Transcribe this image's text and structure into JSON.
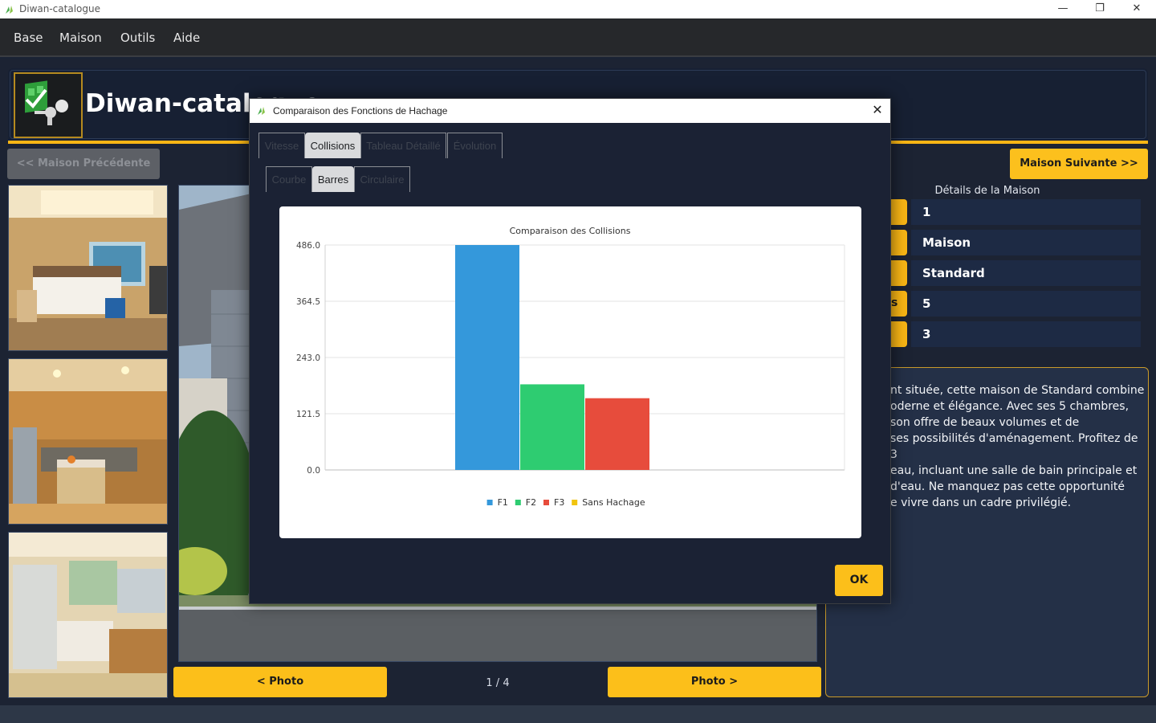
{
  "window": {
    "title": "Diwan-catalogue",
    "controls": [
      "—",
      "❐",
      "✕"
    ]
  },
  "menu": [
    "Base",
    "Maison",
    "Outils",
    "Aide"
  ],
  "header": {
    "app_title": "Diwan-catalogue"
  },
  "nav": {
    "prev_label": "<< Maison Précédente",
    "next_label": "Maison Suivante >>"
  },
  "photos": {
    "prev_label": "< Photo",
    "next_label": "Photo >",
    "counter": "1 / 4"
  },
  "details": {
    "title": "Détails de la Maison",
    "rows": [
      {
        "key_peek": "",
        "value": "1"
      },
      {
        "key_peek": "",
        "value": "Maison"
      },
      {
        "key_peek": "",
        "value": "Standard"
      },
      {
        "key_peek": "s",
        "value": "5"
      },
      {
        "key_peek": "",
        "value": "3"
      }
    ],
    "description": "nt située, cette maison de Standard combine\noderne et élégance. Avec ses 5 chambres,\nson offre de beaux volumes et de\nses possibilités d'aménagement. Profitez de 3\neau, incluant une salle de bain principale et\nd'eau. Ne manquez pas cette opportunité\ne vivre dans un cadre privilégié."
  },
  "dialog": {
    "title": "Comparaison des Fonctions de Hachage",
    "close": "✕",
    "tabs": [
      "Vitesse",
      "Collisions",
      "Tableau Détaillé",
      "Évolution"
    ],
    "active_tab": "Collisions",
    "subtabs": [
      "Courbe",
      "Barres",
      "Circulaire"
    ],
    "active_subtab": "Barres",
    "ok_label": "OK"
  },
  "chart_data": {
    "type": "bar",
    "title": "Comparaison des Collisions",
    "xlabel": "",
    "ylabel": "",
    "ylim": [
      0,
      486
    ],
    "yticks": [
      "0.0",
      "121.5",
      "243.0",
      "364.5",
      "486.0"
    ],
    "grid": true,
    "legend_position": "bottom",
    "series": [
      {
        "name": "F1",
        "value": 486,
        "color": "#3498db"
      },
      {
        "name": "F2",
        "value": 185,
        "color": "#2ecc71"
      },
      {
        "name": "F3",
        "value": 155,
        "color": "#e74c3c"
      },
      {
        "name": "Sans Hachage",
        "value": 0,
        "color": "#f1c40f"
      }
    ]
  }
}
